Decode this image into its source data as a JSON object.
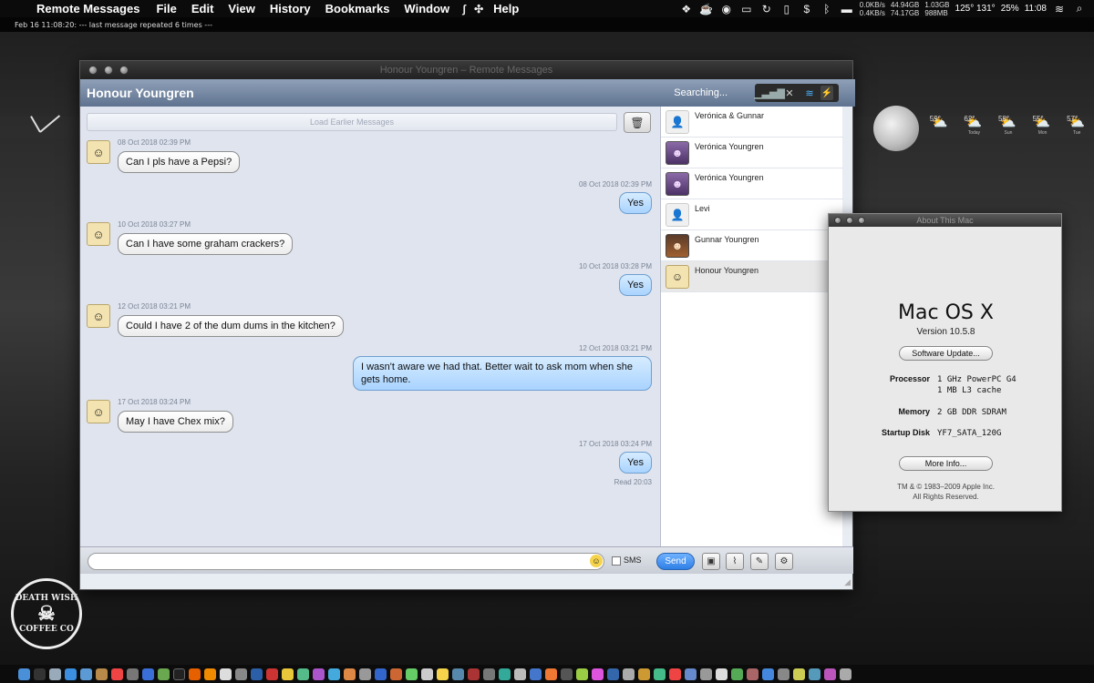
{
  "menubar": {
    "app_name": "Remote Messages",
    "menus": [
      "File",
      "Edit",
      "View",
      "History",
      "Bookmarks",
      "Window",
      "Help"
    ],
    "net_up": "0.0KB/s",
    "net_down": "0.4KB/s",
    "disk_used": "44.94GB",
    "disk_free": "74.17GB",
    "mem_used": "1.03GB",
    "mem_free": "988MB",
    "temps": "125° 131°",
    "battery": "25%",
    "time": "11:08"
  },
  "log_line": "Feb 16 11:08:20: --- last message repeated 6 times ---",
  "weather": [
    {
      "temp": "59°",
      "day": ""
    },
    {
      "temp": "62°",
      "day": "Today"
    },
    {
      "temp": "58°",
      "day": "Sun"
    },
    {
      "temp": "55°",
      "day": "Mon"
    },
    {
      "temp": "57°",
      "day": "Tue"
    }
  ],
  "desktop_logo": {
    "line1": "DEATH WISH",
    "line2": "COFFEE CO"
  },
  "messages_window": {
    "title": "Honour Youngren – Remote Messages",
    "chat_title": "Honour Youngren",
    "status": "Searching...",
    "load_earlier": "Load Earlier Messages",
    "messages": [
      {
        "time": "08 Oct 2018 02:39 PM",
        "text": "Can I pls have a Pepsi?"
      },
      {
        "time": "08 Oct 2018 02:39 PM",
        "text": "Yes"
      },
      {
        "time": "10 Oct 2018 03:27 PM",
        "text": "Can I have some graham crackers?"
      },
      {
        "time": "10 Oct 2018 03:28 PM",
        "text": "Yes"
      },
      {
        "time": "12 Oct 2018 03:21 PM",
        "text": "Could I have 2 of the dum dums in the kitchen?"
      },
      {
        "time": "12 Oct 2018 03:21 PM",
        "text": "I wasn't aware we had that. Better wait to ask mom when she gets home."
      },
      {
        "time": "17 Oct 2018 03:24 PM",
        "text": "May I have Chex mix?"
      },
      {
        "time": "17 Oct 2018 03:24 PM",
        "text": "Yes"
      }
    ],
    "read_receipt": "Read 20:03",
    "compose": {
      "placeholder": "",
      "sms_label": "SMS",
      "send_label": "Send"
    },
    "contacts": [
      {
        "name": "Verónica & Gunnar"
      },
      {
        "name": "Verónica Youngren"
      },
      {
        "name": "Verónica Youngren"
      },
      {
        "name": "Levi"
      },
      {
        "name": "Gunnar Youngren"
      },
      {
        "name": "Honour Youngren"
      }
    ]
  },
  "about_window": {
    "title": "About This Mac",
    "os_name": "Mac OS X",
    "version": "Version 10.5.8",
    "software_update": "Software Update...",
    "processor_label": "Processor",
    "processor_value_1": "1 GHz PowerPC G4",
    "processor_value_2": "1 MB L3 cache",
    "memory_label": "Memory",
    "memory_value": "2 GB DDR SDRAM",
    "startup_label": "Startup Disk",
    "startup_value": "YF7_SATA_120G",
    "more_info": "More Info...",
    "copyright_1": "TM & © 1983–2009 Apple Inc.",
    "copyright_2": "All Rights Reserved."
  },
  "colors": {
    "accent_blue": "#2e7fe6",
    "outgoing_bubble": "#a9d3ff",
    "header_blue": "#5f7390"
  }
}
